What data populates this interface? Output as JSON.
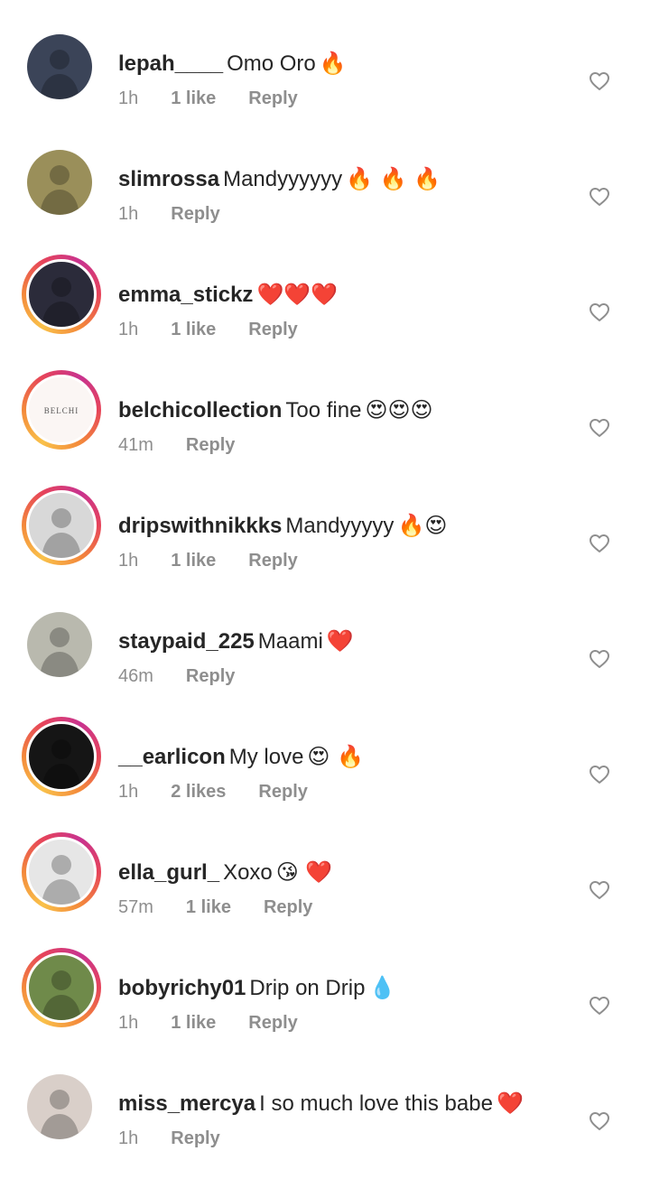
{
  "comments": [
    {
      "username": "lepah____",
      "text": "Omo Oro",
      "emoji": "🔥",
      "time": "1h",
      "likes": "1 like",
      "reply": "Reply",
      "story": false,
      "avatar_color": "#3b4458"
    },
    {
      "username": "slimrossa",
      "text": "Mandyyyyyy",
      "emoji": "🔥 🔥 🔥",
      "time": "1h",
      "likes": "",
      "reply": "Reply",
      "story": false,
      "avatar_color": "#9a8f5a"
    },
    {
      "username": "emma_stickz",
      "text": "",
      "emoji": "❤️❤️❤️",
      "time": "1h",
      "likes": "1 like",
      "reply": "Reply",
      "story": true,
      "avatar_color": "#2b2b3a"
    },
    {
      "username": "belchicollection",
      "text": "Too fine",
      "emoji": "😍😍😍",
      "time": "41m",
      "likes": "",
      "reply": "Reply",
      "story": true,
      "avatar_color": "#fbf6f4"
    },
    {
      "username": "dripswithnikkks",
      "text": "Mandyyyyy",
      "emoji": "🔥😍",
      "time": "1h",
      "likes": "1 like",
      "reply": "Reply",
      "story": true,
      "avatar_color": "#d8d8d8"
    },
    {
      "username": "staypaid_225",
      "text": "Maami",
      "emoji": "❤️",
      "time": "46m",
      "likes": "",
      "reply": "Reply",
      "story": false,
      "avatar_color": "#b9b9ae"
    },
    {
      "username": "__earlicon",
      "text": "My love",
      "emoji": "😍 🔥",
      "time": "1h",
      "likes": "2 likes",
      "reply": "Reply",
      "story": true,
      "avatar_color": "#151515"
    },
    {
      "username": "ella_gurl_",
      "text": "Xoxo",
      "emoji": "😘 ❤️",
      "time": "57m",
      "likes": "1 like",
      "reply": "Reply",
      "story": true,
      "avatar_color": "#e6e6e6"
    },
    {
      "username": "bobyrichy01",
      "text": "Drip on Drip",
      "emoji": "💧",
      "time": "1h",
      "likes": "1 like",
      "reply": "Reply",
      "story": true,
      "avatar_color": "#6f8a4a"
    },
    {
      "username": "miss_mercya",
      "text": "I so much love this babe",
      "emoji": "❤️",
      "time": "1h",
      "likes": "",
      "reply": "Reply",
      "story": false,
      "avatar_color": "#d9cfc9"
    }
  ],
  "avatar_labels": {
    "belchi": "BELCHI"
  },
  "colors": {
    "meta": "#8e8e8e",
    "text": "#262626",
    "heart_outline": "#8e8e8e"
  }
}
